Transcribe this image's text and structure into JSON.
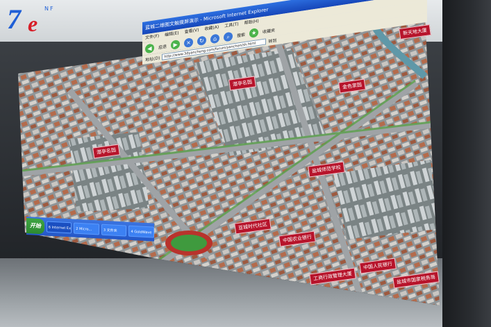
{
  "logo": {
    "main": "7",
    "accent": "e",
    "sub": "NF"
  },
  "browser": {
    "title": "蓝城二维图文触摸屏演示 - Microsoft Internet Explorer",
    "menu": [
      "文件(F)",
      "编辑(E)",
      "查看(V)",
      "收藏(A)",
      "工具(T)",
      "帮助(H)"
    ],
    "toolbar": {
      "back_label": "后退",
      "search_label": "搜索",
      "favorites_label": "收藏夹"
    },
    "address_label": "地址(D)",
    "url": "http://www.3dyancheng.com/forum/yanchen/sh.html",
    "go_label": "转到"
  },
  "taskbar": {
    "start_label": "开始",
    "items": [
      "6 Internet Expl",
      "2 Micro...",
      "3 文件夹",
      "4 GoldWave"
    ]
  },
  "map_labels": [
    "潜亭名园",
    "金色家园",
    "潜亭名园",
    "盐城师范学校",
    "亚城时代社区",
    "中国农业银行",
    "中国人民银行",
    "工商行政管理大厦",
    "盐城市国家税务局",
    "新天地大厦"
  ],
  "colors": {
    "accent": "#b7142b",
    "xp_blue": "#2457c7",
    "xp_green": "#2d8a30"
  }
}
